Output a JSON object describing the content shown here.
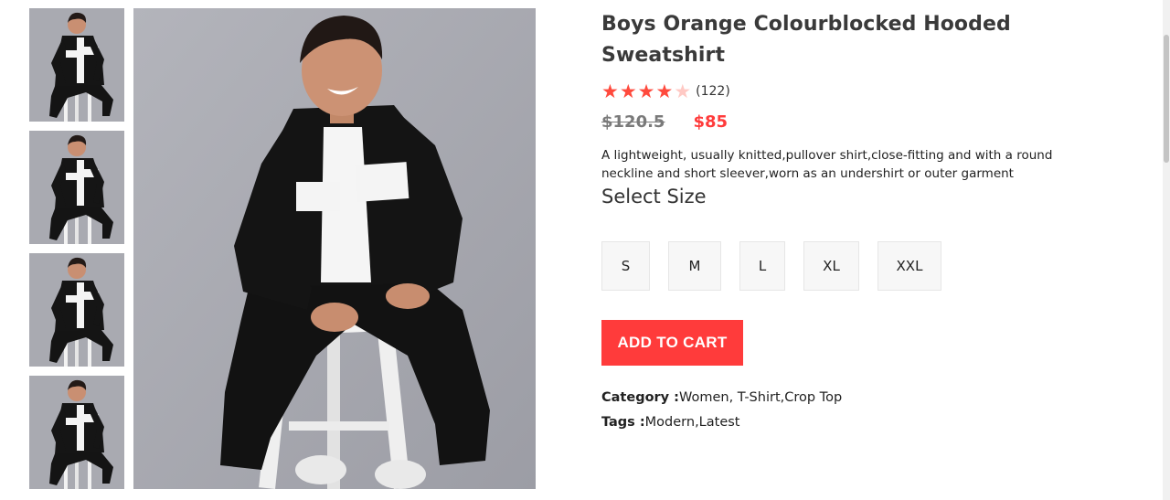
{
  "product": {
    "title": "Boys Orange Colourblocked Hooded Sweatshirt",
    "rating": 4,
    "rating_max": 5,
    "review_count": "(122)",
    "old_price": "$120.5",
    "new_price": "$85",
    "description": "A lightweight, usually knitted,pullover shirt,close-fitting and with a round neckline and short sleever,worn as an undershirt or outer garment"
  },
  "size_selector": {
    "heading": "Select Size",
    "options": [
      "S",
      "M",
      "L",
      "XL",
      "XXL"
    ]
  },
  "cart": {
    "add_label": "ADD TO CART"
  },
  "meta": {
    "category_label": "Category :",
    "category_value": "Women, T-Shirt,Crop Top",
    "tags_label": "Tags :",
    "tags_value": "Modern,Latest"
  },
  "gallery": {
    "thumbnail_count": 4,
    "main_image": "boy-sitting-on-stool-photo"
  },
  "colors": {
    "accent": "#ff3b3b",
    "star": "#ff4a3d",
    "star_empty": "#ffc9c4",
    "photo_bg": "#a8a9b0"
  }
}
